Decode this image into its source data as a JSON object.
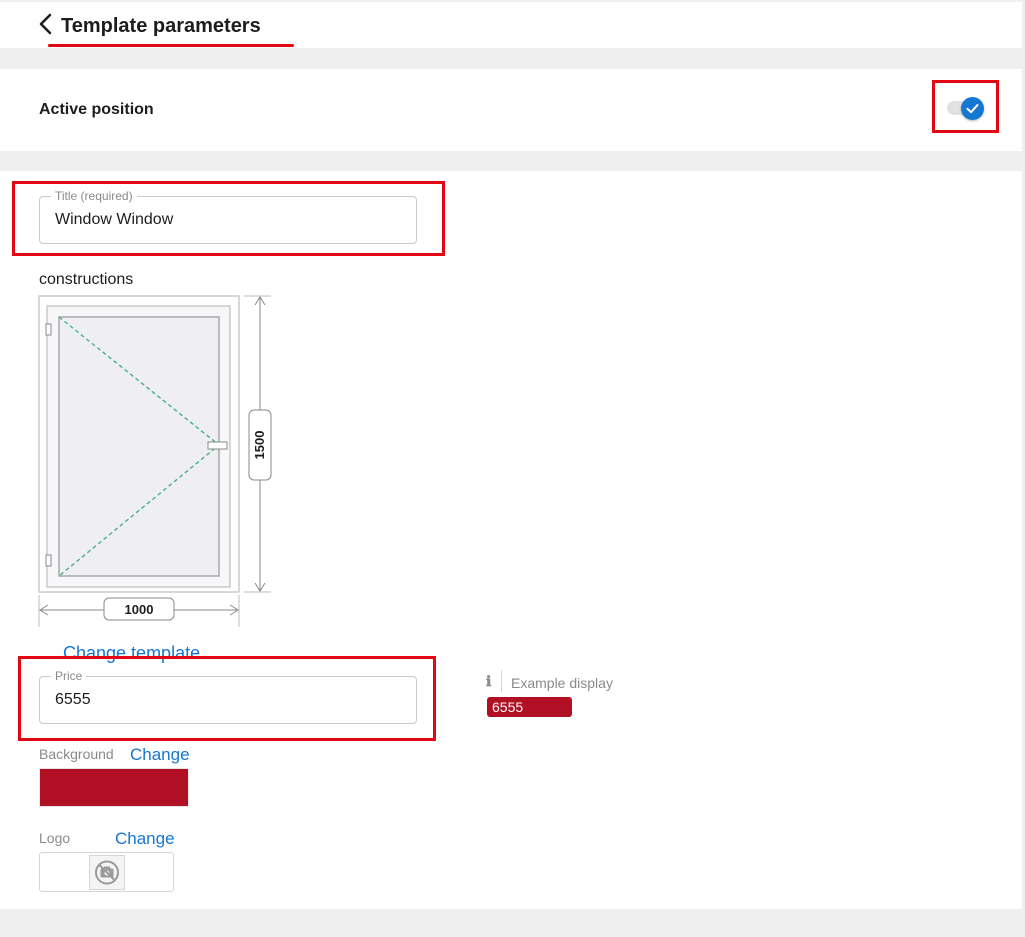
{
  "header": {
    "title": "Template parameters"
  },
  "active_position": {
    "label": "Active position",
    "enabled": true
  },
  "title_field": {
    "legend": "Title (required)",
    "value": "Window Window"
  },
  "constructions": {
    "label": "constructions",
    "width_label": "1000",
    "height_label": "1500",
    "change_template_label": "Change template"
  },
  "price_field": {
    "legend": "Price",
    "value": "6555"
  },
  "example": {
    "label": "Example display",
    "badge_text": "6555",
    "info_icon": "info-icon"
  },
  "background": {
    "label": "Background",
    "change_label": "Change",
    "color": "#b10f23"
  },
  "logo": {
    "label": "Logo",
    "change_label": "Change",
    "placeholder_icon": "no-camera-icon"
  },
  "colors": {
    "accent": "#1677d2",
    "highlight": "#e30613",
    "brand": "#b10f23"
  }
}
